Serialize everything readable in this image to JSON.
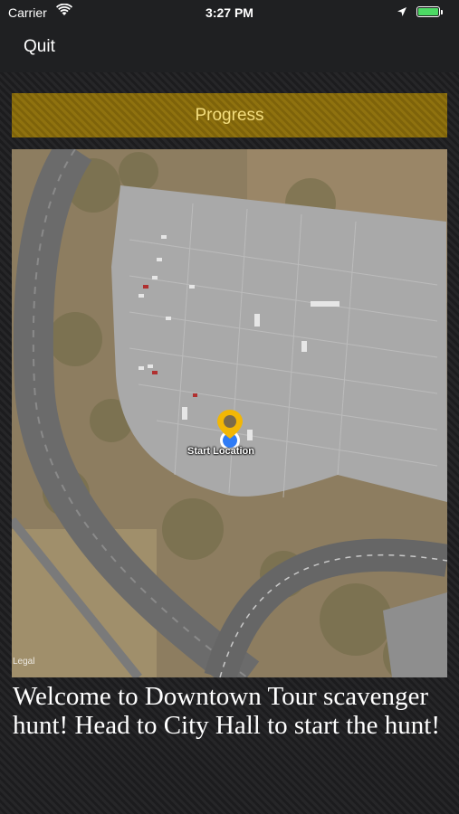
{
  "status_bar": {
    "carrier": "Carrier",
    "time": "3:27 PM",
    "wifi_icon": "wifi-icon",
    "location_icon": "location-arrow-icon",
    "battery_icon": "battery-icon",
    "battery_color": "#4cd964"
  },
  "nav": {
    "quit_label": "Quit"
  },
  "progress": {
    "label": "Progress",
    "color": "#8a6d0c"
  },
  "map": {
    "pin_label": "Start Location",
    "legal_label": "Legal",
    "pin_color": "#f2b705",
    "user_dot_color": "#2f7cf6"
  },
  "message": {
    "text": "Welcome to Downtown Tour scavenger hunt! Head to City Hall to start the hunt!"
  }
}
